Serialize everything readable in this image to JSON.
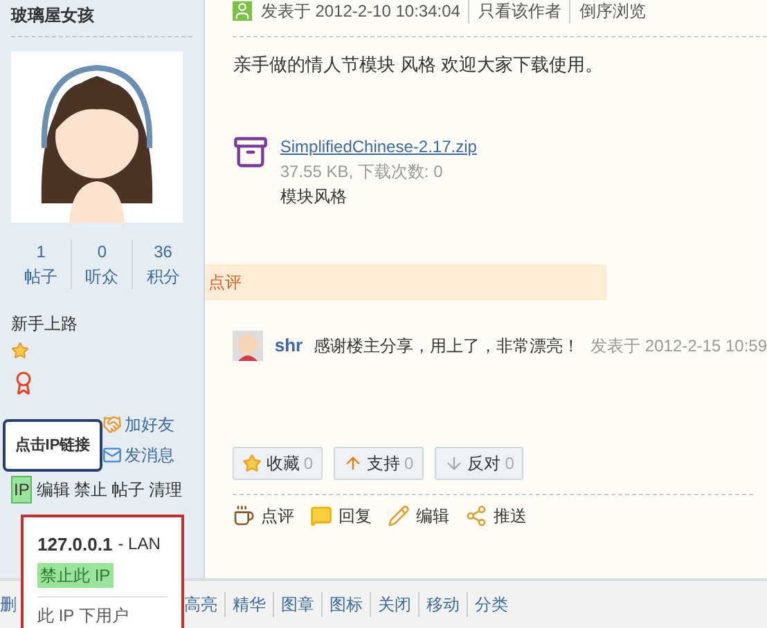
{
  "author": {
    "name": "玻璃屋女孩",
    "stats": [
      {
        "value": "1",
        "label": "帖子"
      },
      {
        "value": "0",
        "label": "听众"
      },
      {
        "value": "36",
        "label": "积分"
      }
    ],
    "rank": "新手上路",
    "social": [
      {
        "kind": "friend",
        "label": "加好友"
      },
      {
        "kind": "message",
        "label": "发消息"
      }
    ],
    "admin_links": [
      {
        "label": "IP",
        "selected": true
      },
      {
        "label": "编辑",
        "selected": false
      },
      {
        "label": "禁止",
        "selected": false
      },
      {
        "label": "帖子",
        "selected": false
      },
      {
        "label": "清理",
        "selected": false
      }
    ]
  },
  "tooltip": "点击IP链接",
  "ip_popup": {
    "address": "127.0.0.1",
    "network": "- LAN",
    "ban": "禁止此 IP",
    "users": "此 IP 下用户"
  },
  "post": {
    "posted": "发表于 2012-2-10 10:34:04",
    "links": [
      "只看该作者",
      "倒序浏览"
    ],
    "body": "亲手做的情人节模块 风格 欢迎大家下载使用。",
    "attachment": {
      "file": "SimplifiedChinese-2.17.zip",
      "meta": "37.55 KB, 下载次数: 0",
      "description": "模块风格"
    }
  },
  "comments": {
    "title": "点评",
    "items": [
      {
        "user": "shr",
        "text": "感谢楼主分享，用上了，非常漂亮！",
        "time": "发表于 2012-2-15 10:59"
      }
    ]
  },
  "votes": [
    {
      "kind": "favorite",
      "label": "收藏",
      "count": "0"
    },
    {
      "kind": "up",
      "label": "支持",
      "count": "0"
    },
    {
      "kind": "down",
      "label": "反对",
      "count": "0"
    }
  ],
  "actions": [
    {
      "kind": "rate",
      "label": "点评"
    },
    {
      "kind": "reply",
      "label": "回复"
    },
    {
      "kind": "edit",
      "label": "编辑"
    },
    {
      "kind": "share",
      "label": "推送"
    }
  ],
  "admin_bar": [
    "删",
    "高亮",
    "精华",
    "图章",
    "图标",
    "关闭",
    "移动",
    "分类"
  ]
}
